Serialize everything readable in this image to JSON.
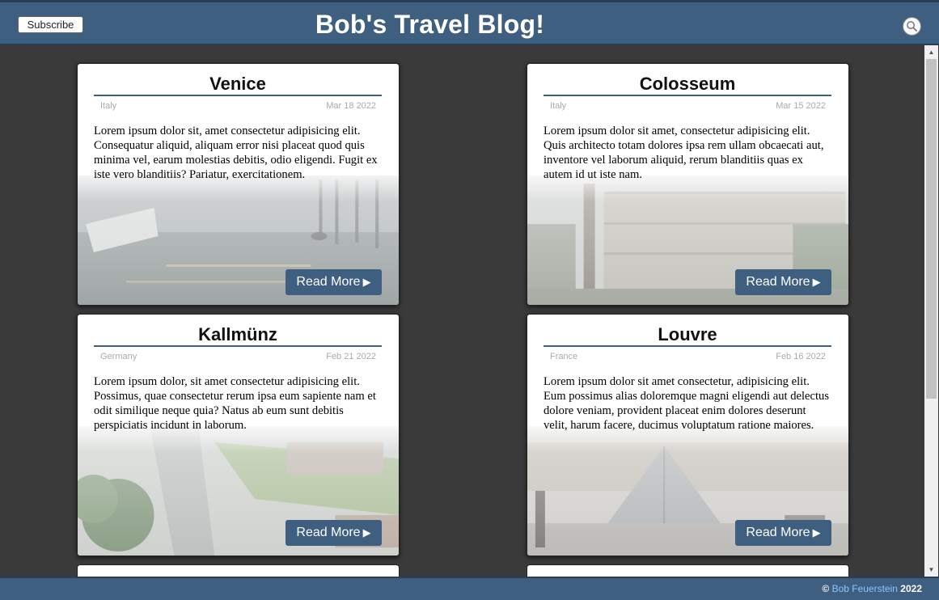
{
  "header": {
    "subscribe_label": "Subscribe",
    "title": "Bob's Travel Blog!",
    "search_icon": "search-icon"
  },
  "posts": [
    {
      "title": "Venice",
      "country": "Italy",
      "date": "Mar 18 2022",
      "excerpt": "Lorem ipsum dolor sit, amet consectetur adipisicing elit. Consequatur aliquid, aliquam error nisi placeat quod quis minima vel, earum molestias debitis, odio eligendi. Fugit ex iste vero blanditiis? Pariatur, exercitationem.",
      "read_more": "Read More"
    },
    {
      "title": "Colosseum",
      "country": "Italy",
      "date": "Mar 15 2022",
      "excerpt": "Lorem ipsum dolor sit amet, consectetur adipisicing elit. Quis architecto totam dolores ipsa rem ullam obcaecati aut, inventore vel laborum aliquid, rerum blanditiis quas ex autem id ut iste nam.",
      "read_more": "Read More"
    },
    {
      "title": "Kallmünz",
      "country": "Germany",
      "date": "Feb 21 2022",
      "excerpt": "Lorem ipsum dolor, sit amet consectetur adipisicing elit. Possimus, quae consectetur rerum ipsa eum sapiente nam et odit similique neque quia? Natus ab eum sunt debitis perspiciatis incidunt in laborum.",
      "read_more": "Read More"
    },
    {
      "title": "Louvre",
      "country": "France",
      "date": "Feb 16 2022",
      "excerpt": "Lorem ipsum dolor sit amet consectetur, adipisicing elit. Eum possimus alias doloremque magni eligendi aut delectus dolore veniam, provident placeat enim dolores deserunt velit, harum facere, ducimus voluptatum ratione maiores.",
      "read_more": "Read More"
    }
  ],
  "footer": {
    "copyright": "©",
    "author": "Bob Feuerstein",
    "year": "2022"
  },
  "colors": {
    "brand": "#3f5f80",
    "background": "#3a3a3a",
    "footer_link": "#8fc2ff"
  }
}
